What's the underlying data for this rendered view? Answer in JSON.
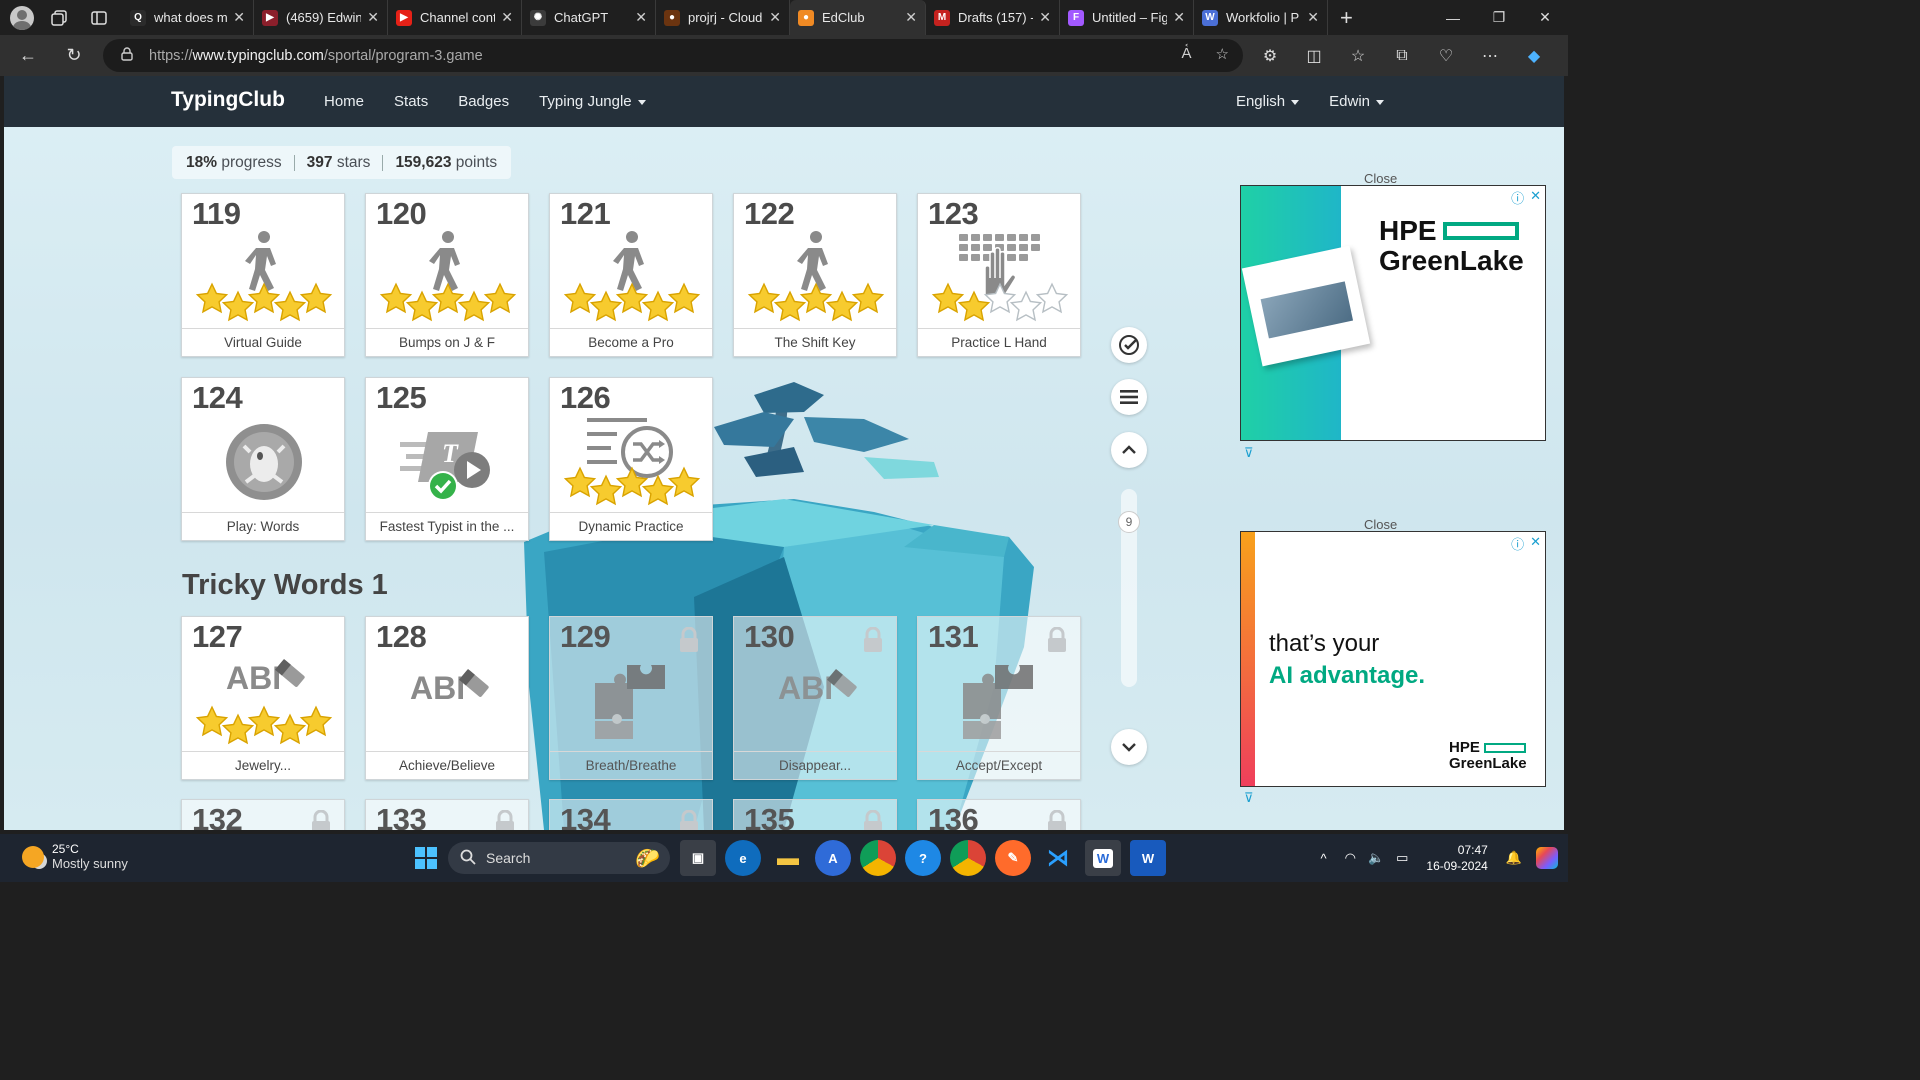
{
  "browser": {
    "tabs": [
      {
        "title": "what does m",
        "fav_color": "#2b2b2b",
        "fav_text": "Q",
        "active": false,
        "width": 132
      },
      {
        "title": "(4659) Edwin",
        "fav_color": "#8b1f2b",
        "fav_text": "▶",
        "active": false,
        "width": 134
      },
      {
        "title": "Channel cont",
        "fav_color": "#e62117",
        "fav_text": "▶",
        "active": false,
        "width": 134
      },
      {
        "title": "ChatGPT",
        "fav_color": "#3b3b3b",
        "fav_text": "✺",
        "active": false,
        "width": 134
      },
      {
        "title": "projrj - Cloud",
        "fav_color": "#6b3410",
        "fav_text": "●",
        "active": false,
        "width": 134
      },
      {
        "title": "EdClub",
        "fav_color": "#f08a24",
        "fav_text": "●",
        "active": true,
        "width": 136
      },
      {
        "title": "Drafts (157) -",
        "fav_color": "#c5221f",
        "fav_text": "M",
        "active": false,
        "width": 134
      },
      {
        "title": "Untitled – Fig",
        "fav_color": "#a259ff",
        "fav_text": "F",
        "active": false,
        "width": 134
      },
      {
        "title": "Workfolio | P",
        "fav_color": "#4b6fd6",
        "fav_text": "W",
        "active": false,
        "width": 134
      }
    ],
    "url_prefix": "https://",
    "url_host": "www.typingclub.com",
    "url_path": "/sportal/program-3.game"
  },
  "site": {
    "brand": "TypingClub",
    "nav": [
      "Home",
      "Stats",
      "Badges",
      "Typing Jungle"
    ],
    "language": "English",
    "user": "Edwin"
  },
  "progress": {
    "percent": "18%",
    "percent_label": "progress",
    "stars": "397",
    "stars_label": "stars",
    "points": "159,623",
    "points_label": "points"
  },
  "section_title": "Tricky Words 1",
  "lessons_row1": [
    {
      "num": "119",
      "label": "Virtual Guide",
      "icon": "walker-icon",
      "stars": 5
    },
    {
      "num": "120",
      "label": "Bumps on J & F",
      "icon": "walker-icon",
      "stars": 5
    },
    {
      "num": "121",
      "label": "Become a Pro",
      "icon": "walker-icon",
      "stars": 5
    },
    {
      "num": "122",
      "label": "The Shift Key",
      "icon": "walker-icon",
      "stars": 5
    },
    {
      "num": "123",
      "label": "Practice L Hand",
      "icon": "keyboard-hand-icon",
      "stars": 2
    }
  ],
  "lessons_row2": [
    {
      "num": "124",
      "label": "Play: Words",
      "icon": "game-icon",
      "stars": 0
    },
    {
      "num": "125",
      "label": "Fastest Typist in the ...",
      "icon": "speed-test-icon",
      "stars": 0
    },
    {
      "num": "126",
      "label": "Dynamic Practice",
      "icon": "shuffle-icon",
      "stars": 5
    }
  ],
  "lessons_row3": [
    {
      "num": "127",
      "label": "Jewelry...",
      "icon": "abc-eraser-icon",
      "stars": 5,
      "locked": false
    },
    {
      "num": "128",
      "label": "Achieve/Believe",
      "icon": "abc-eraser-icon",
      "stars": 0,
      "locked": false
    },
    {
      "num": "129",
      "label": "Breath/Breathe",
      "icon": "puzzle-icon",
      "stars": 0,
      "locked": true
    },
    {
      "num": "130",
      "label": "Disappear...",
      "icon": "abc-eraser-icon",
      "stars": 0,
      "locked": true
    },
    {
      "num": "131",
      "label": "Accept/Except",
      "icon": "puzzle-icon",
      "stars": 0,
      "locked": true
    }
  ],
  "lessons_row4": [
    {
      "num": "132",
      "locked": true
    },
    {
      "num": "133",
      "locked": true
    },
    {
      "num": "134",
      "locked": true
    },
    {
      "num": "135",
      "locked": true
    },
    {
      "num": "136",
      "locked": true
    }
  ],
  "side": {
    "page_number": "9"
  },
  "ads": {
    "close_label": "Close",
    "ad1_brand_line1": "HPE",
    "ad1_brand_line2": "GreenLake",
    "ad2_text_line1": "that’s your",
    "ad2_text_line2": "AI advantage.",
    "ad2_logo_line1": "HPE",
    "ad2_logo_line2": "GreenLake"
  },
  "taskbar": {
    "temperature": "25°C",
    "weather": "Mostly sunny",
    "search_placeholder": "Search",
    "time": "07:47",
    "date": "16-09-2024"
  },
  "colors": {
    "header_bg": "#25303a",
    "star": "#f5c518",
    "ad_teal": "#01a982"
  }
}
